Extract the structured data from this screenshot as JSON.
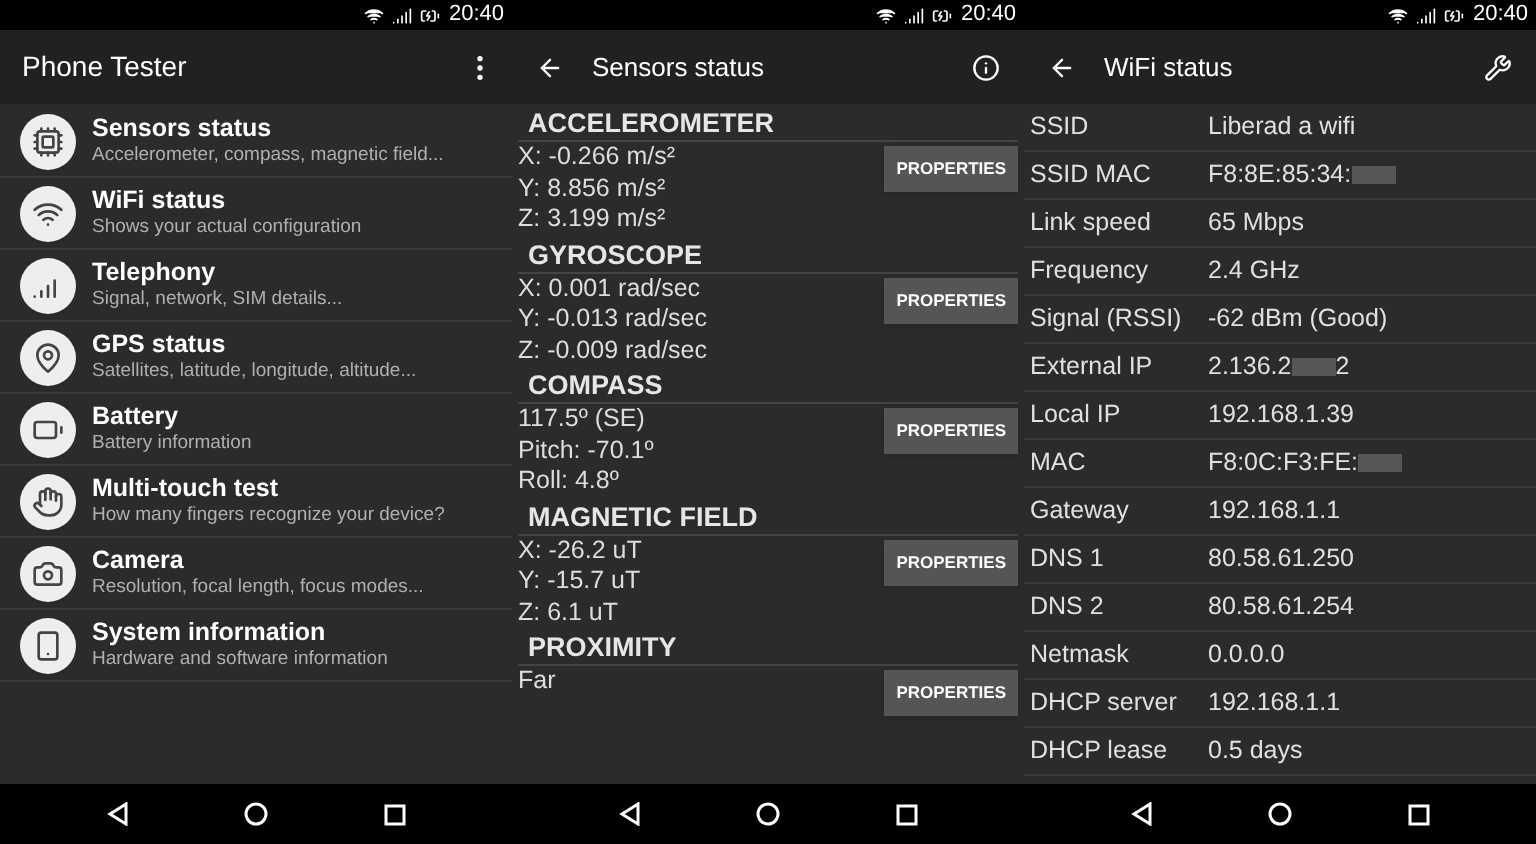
{
  "screens": [
    {
      "kind": "menu",
      "status_time": "20:40",
      "title": "Phone Tester",
      "items": [
        {
          "title": "Sensors status",
          "subtitle": "Accelerometer, compass, magnetic field..."
        },
        {
          "title": "WiFi status",
          "subtitle": "Shows your actual configuration"
        },
        {
          "title": "Telephony",
          "subtitle": "Signal, network, SIM details..."
        },
        {
          "title": "GPS status",
          "subtitle": "Satellites, latitude, longitude, altitude..."
        },
        {
          "title": "Battery",
          "subtitle": "Battery information"
        },
        {
          "title": "Multi-touch test",
          "subtitle": "How many fingers recognize your device?"
        },
        {
          "title": "Camera",
          "subtitle": "Resolution, focal length, focus modes..."
        },
        {
          "title": "System information",
          "subtitle": "Hardware and software information"
        }
      ]
    },
    {
      "kind": "sensors",
      "status_time": "20:40",
      "title": "Sensors status",
      "sections": [
        {
          "heading": "ACCELEROMETER",
          "lines": [
            "X: -0.266 m/s²",
            "Y: 8.856 m/s²",
            "Z: 3.199 m/s²"
          ],
          "button": "PROPERTIES"
        },
        {
          "heading": "GYROSCOPE",
          "lines": [
            "X: 0.001 rad/sec",
            "Y: -0.013 rad/sec",
            "Z: -0.009 rad/sec"
          ],
          "button": "PROPERTIES"
        },
        {
          "heading": "COMPASS",
          "lines": [
            "117.5º (SE)",
            "Pitch: -70.1º",
            "Roll: 4.8º"
          ],
          "button": "PROPERTIES"
        },
        {
          "heading": "MAGNETIC FIELD",
          "lines": [
            "X: -26.2 uT",
            "Y: -15.7 uT",
            "Z: 6.1 uT"
          ],
          "button": "PROPERTIES"
        },
        {
          "heading": "PROXIMITY",
          "lines": [
            "Far"
          ],
          "button": "PROPERTIES"
        }
      ]
    },
    {
      "kind": "wifi",
      "status_time": "20:40",
      "title": "WiFi status",
      "rows": [
        {
          "label": "SSID",
          "value": "Liberad a wifi"
        },
        {
          "label": "SSID MAC",
          "value": "F8:8E:85:34:",
          "redacted": true
        },
        {
          "label": "Link speed",
          "value": "65 Mbps"
        },
        {
          "label": "Frequency",
          "value": "2.4 GHz"
        },
        {
          "label": "Signal (RSSI)",
          "value": "-62 dBm (Good)"
        },
        {
          "label": "External IP",
          "value": "2.136.2",
          "redacted": true,
          "value_end": "2"
        },
        {
          "label": "Local IP",
          "value": "192.168.1.39"
        },
        {
          "label": "MAC",
          "value": "F8:0C:F3:FE:",
          "redacted": true
        },
        {
          "label": "Gateway",
          "value": "192.168.1.1"
        },
        {
          "label": "DNS 1",
          "value": "80.58.61.250"
        },
        {
          "label": "DNS 2",
          "value": "80.58.61.254"
        },
        {
          "label": "Netmask",
          "value": "0.0.0.0"
        },
        {
          "label": "DHCP server",
          "value": "192.168.1.1"
        },
        {
          "label": "DHCP lease",
          "value": "0.5 days"
        }
      ]
    }
  ]
}
